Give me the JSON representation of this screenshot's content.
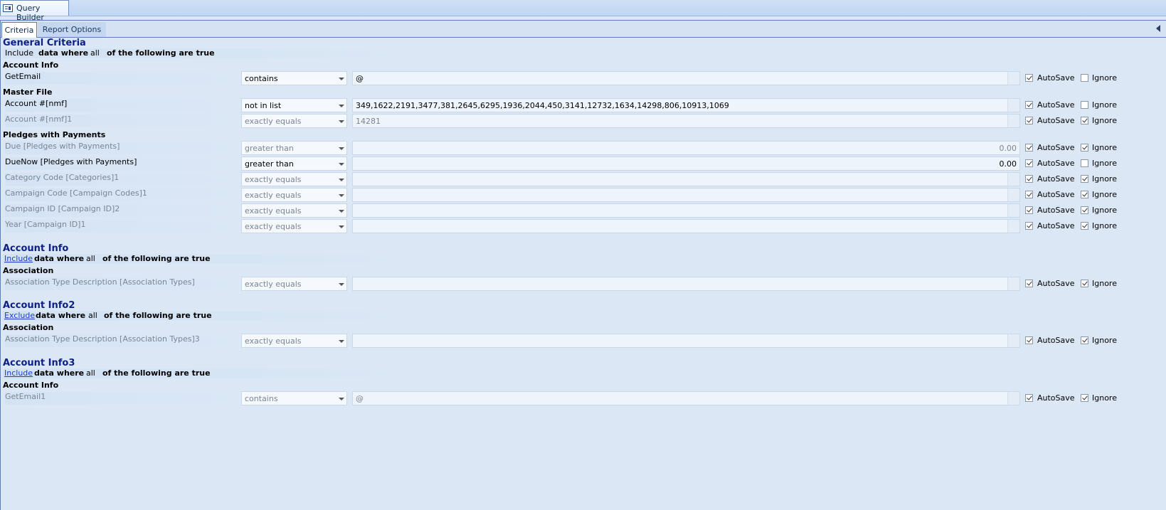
{
  "doc_tab": {
    "label": "Query Builder",
    "icon": "query-builder-icon"
  },
  "inner_tabs": [
    "Criteria",
    "Report Options"
  ],
  "labels": {
    "autosave": "AutoSave",
    "ignore": "Ignore"
  },
  "sections": [
    {
      "title": "General Criteria",
      "mode": "Include",
      "mode_link": false,
      "data_where": "data where",
      "quantifier": "all",
      "tail": "of the following are true",
      "groups": [
        {
          "label": "Account Info",
          "rows": [
            {
              "field": "GetEmail",
              "operator": "contains",
              "value": "@",
              "disabled": false,
              "autosave": true,
              "ignore": false
            }
          ]
        },
        {
          "label": "Master File",
          "rows": [
            {
              "field": "Account #[nmf]",
              "operator": "not in list",
              "value": "349,1622,2191,3477,381,2645,6295,1936,2044,450,3141,12732,1634,14298,806,10913,1069",
              "disabled": false,
              "autosave": true,
              "ignore": false
            },
            {
              "field": "Account #[nmf]1",
              "operator": "exactly equals",
              "value": "14281",
              "disabled": true,
              "autosave": true,
              "ignore": true
            }
          ]
        },
        {
          "label": "Pledges with Payments",
          "rows": [
            {
              "field": "Due [Pledges with Payments]",
              "operator": "greater than",
              "number": "0.00",
              "disabled": true,
              "autosave": true,
              "ignore": true
            },
            {
              "field": "DueNow [Pledges with Payments]",
              "operator": "greater than",
              "number": "0.00",
              "disabled": false,
              "autosave": true,
              "ignore": false
            },
            {
              "field": "Category Code [Categories]1",
              "operator": "exactly equals",
              "value": "",
              "disabled": true,
              "autosave": true,
              "ignore": true
            },
            {
              "field": "Campaign Code [Campaign Codes]1",
              "operator": "exactly equals",
              "value": "",
              "disabled": true,
              "autosave": true,
              "ignore": true
            },
            {
              "field": "Campaign ID [Campaign ID]2",
              "operator": "exactly equals",
              "value": "",
              "disabled": true,
              "autosave": true,
              "ignore": true
            },
            {
              "field": "Year [Campaign ID]1",
              "operator": "exactly equals",
              "value": "",
              "disabled": true,
              "autosave": true,
              "ignore": true
            }
          ]
        }
      ]
    },
    {
      "title": "Account Info",
      "mode": "Include",
      "mode_link": true,
      "data_where": "data where",
      "quantifier": "all",
      "tail": "of the following are true",
      "groups": [
        {
          "label": "Association",
          "rows": [
            {
              "field": "Association Type Description [Association Types]",
              "operator": "exactly equals",
              "value": "",
              "disabled": true,
              "autosave": true,
              "ignore": true
            }
          ]
        }
      ]
    },
    {
      "title": "Account Info2",
      "mode": "Exclude",
      "mode_link": true,
      "data_where": "data where",
      "quantifier": "all",
      "tail": "of the following are true",
      "groups": [
        {
          "label": "Association",
          "rows": [
            {
              "field": "Association Type Description [Association Types]3",
              "operator": "exactly equals",
              "value": "",
              "disabled": true,
              "autosave": true,
              "ignore": true
            }
          ]
        }
      ]
    },
    {
      "title": "Account Info3",
      "mode": "Include",
      "mode_link": true,
      "data_where": "data where",
      "quantifier": "all",
      "tail": "of the following are true",
      "groups": [
        {
          "label": "Account Info",
          "rows": [
            {
              "field": "GetEmail1",
              "operator": "contains",
              "value": "@",
              "disabled": true,
              "autosave": true,
              "ignore": true
            }
          ]
        }
      ]
    }
  ]
}
